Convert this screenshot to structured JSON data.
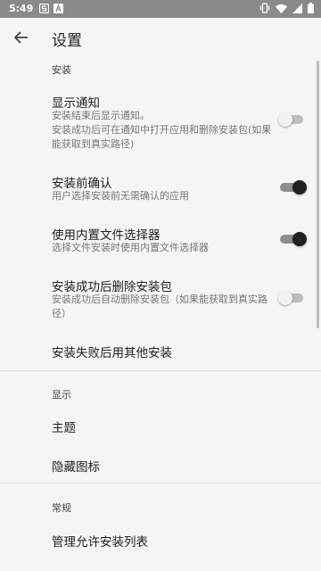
{
  "status_bar": {
    "time": "5:49"
  },
  "app_bar": {
    "title": "设置"
  },
  "sections": {
    "install": "安装",
    "display": "显示",
    "general": "常规"
  },
  "settings": {
    "notify": {
      "title": "显示通知",
      "subtitle": "安装结束后显示通知。\n安装成功后可在通知中打开应用和删除安装包(如果能获取到真实路径)",
      "enabled": false
    },
    "confirm": {
      "title": "安装前确认",
      "subtitle": "用户选择安装前无需确认的应用",
      "enabled": true
    },
    "picker": {
      "title": "使用内置文件选择器",
      "subtitle": "选择文件安装时使用内置文件选择器",
      "enabled": true
    },
    "delete_after": {
      "title": "安装成功后删除安装包",
      "subtitle": "安装成功后自动删除安装包（如果能获取到真实路径）",
      "enabled": false
    },
    "fallback": {
      "title": "安装失败后用其他安装"
    },
    "theme": {
      "title": "主题"
    },
    "hide_icon": {
      "title": "隐藏图标"
    },
    "allow_list": {
      "title": "管理允许安装列表"
    }
  },
  "colors": {
    "status_bar": "#8a8a8a",
    "background": "#f5f5f5",
    "toggle_on_thumb": "#212121",
    "toggle_off_thumb": "#f1f1f1"
  }
}
